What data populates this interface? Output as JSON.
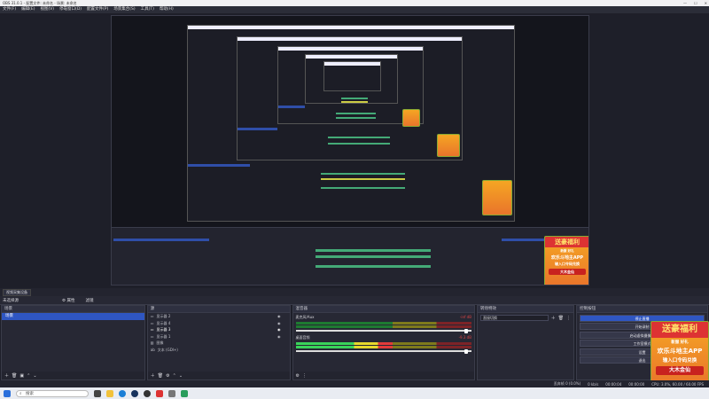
{
  "window": {
    "title": "OBS 31.0.1 - 配置文件: 未命名 - 场景: 未命名",
    "controls": [
      "—",
      "☐",
      "✕"
    ]
  },
  "menu": [
    "文件(F)",
    "编辑(E)",
    "视图(V)",
    "停靠窗口(D)",
    "配置文件(P)",
    "场景集合(S)",
    "工具(T)",
    "帮助(H)"
  ],
  "toolbar": {
    "source_dropdown": "视频采集设备",
    "properties": "属性",
    "filters": "滤镜"
  },
  "dock_strip": {
    "title": "未选择源",
    "properties": "⚙ 属性",
    "filters": "滤镜"
  },
  "scenes": {
    "title": "场景",
    "items": [
      {
        "label": "场景"
      }
    ]
  },
  "sources": {
    "title": "源",
    "items": [
      "显示器 2",
      "显示器 4",
      "显示器 3",
      "显示器 1",
      "图像",
      "文本 (GDI+)"
    ]
  },
  "mixer": {
    "title": "混音器",
    "tracks": [
      {
        "name": "麦克风/Aux",
        "level": "-inf dB",
        "fill": 0.0,
        "volume": 0.98
      },
      {
        "name": "桌面音频",
        "level": "-9.3 dB",
        "fill": 0.55,
        "volume": 0.98
      }
    ]
  },
  "transitions": {
    "title": "转场特效",
    "selected": "直接切换"
  },
  "controls": {
    "title": "控制按钮",
    "buttons": [
      "停止直播",
      "开始录制",
      "启动虚拟摄像机",
      "工作室模式",
      "设置",
      "退出"
    ]
  },
  "ad": {
    "header": "送豪福利",
    "line1": "新服 好礼",
    "line2": "欢乐斗地主APP",
    "line3": "输入口令码兑换",
    "button": "大木金仙"
  },
  "status": {
    "frames": "丢弃帧 0 (0.0%)",
    "bitrate": "0 kb/s",
    "time": "00:00:04",
    "rec": "00:00:00",
    "cpu": "CPU: 3.0%, 60.00 / 60.00 FPS"
  },
  "taskbar": {
    "search": "搜索",
    "icons": [
      "开始",
      "搜索",
      "任务视图",
      "文件资源管理器",
      "Edge",
      "Steam",
      "OBS",
      "游戏",
      "设置",
      "应用"
    ]
  },
  "colors": {
    "accent": "#2f56c2",
    "bg": "#1e1f29",
    "panel": "#272834"
  }
}
